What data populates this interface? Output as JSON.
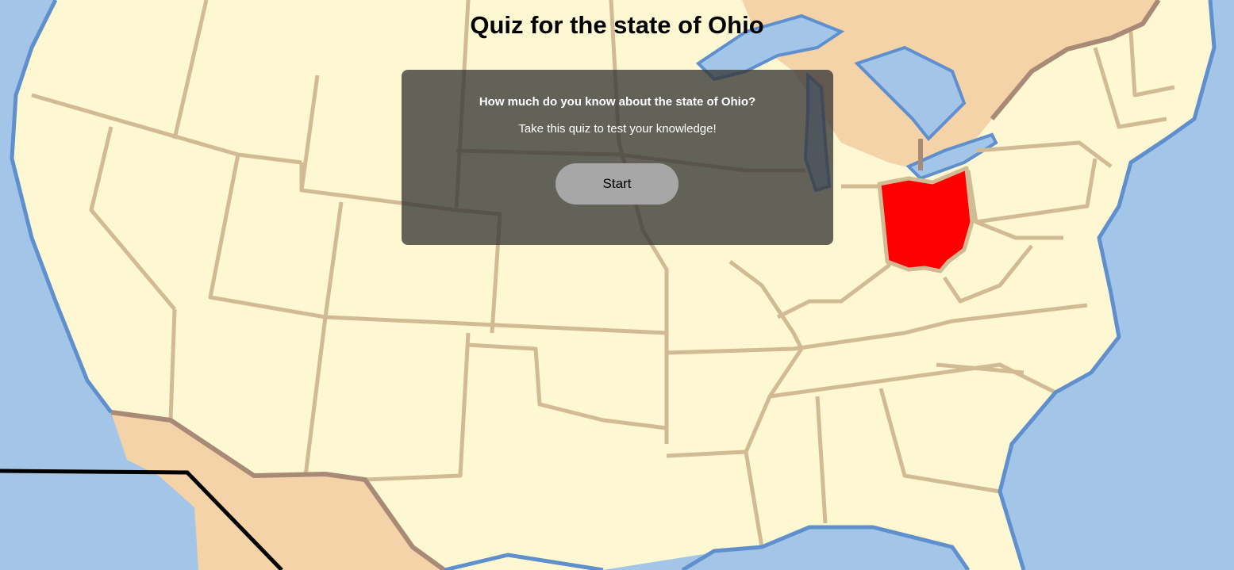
{
  "page": {
    "title": "Quiz for the state of Ohio"
  },
  "quiz": {
    "question": "How much do you know about the state of Ohio?",
    "subtitle": "Take this quiz to test your knowledge!",
    "start_label": "Start"
  },
  "map": {
    "highlighted_state": "Ohio",
    "colors": {
      "water": "#a2c5e8",
      "land_us": "#fdf8d2",
      "land_foreign": "#f5d3a8",
      "state_border": "#d2bb94",
      "country_border": "#a88a76",
      "coast": "#5f8fcd",
      "highlight": "#ff0000"
    }
  }
}
